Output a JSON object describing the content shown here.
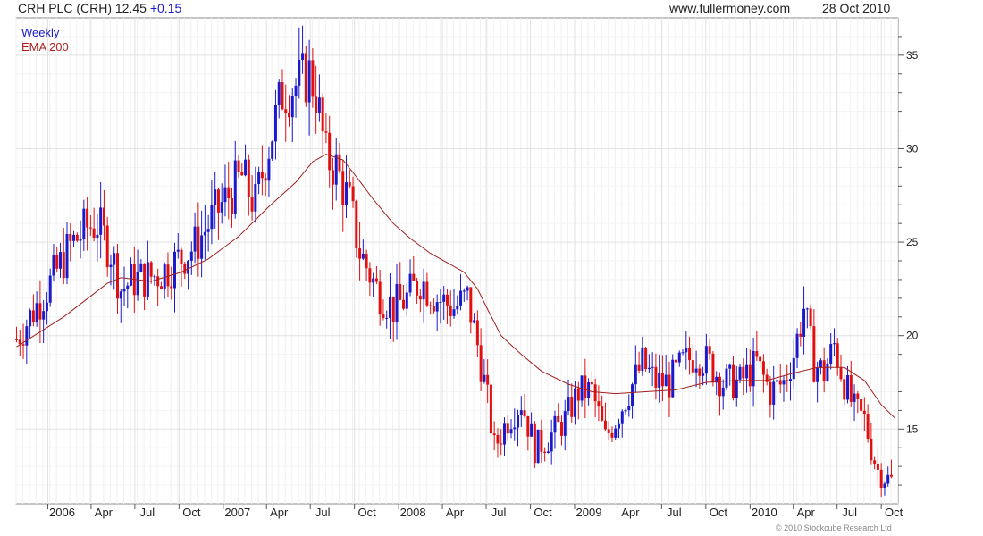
{
  "header": {
    "title": "CRH PLC (CRH) 12.45",
    "change": "+0.15",
    "site": "www.fullermoney.com",
    "date": "28 Oct 2010"
  },
  "legend": {
    "weekly": "Weekly",
    "ema": "EMA 200"
  },
  "copyright": "© 2010 Stockcube Research Ltd",
  "colors": {
    "up": "#1a1acc",
    "down": "#e01010",
    "ema": "#a02020",
    "grid": "#e2e2e2"
  },
  "chart_data": {
    "type": "candlestick",
    "title": "CRH PLC (CRH) 12.45 +0.15",
    "ylim": [
      11,
      37
    ],
    "yticks": [
      15,
      20,
      25,
      30,
      35
    ],
    "xlim": [
      "2005-10-27",
      "2010-11-05"
    ],
    "xticks": [
      {
        "label": "2006",
        "date": "2006-01-01"
      },
      {
        "label": "Apr",
        "date": "2006-04-01"
      },
      {
        "label": "Jul",
        "date": "2006-07-01"
      },
      {
        "label": "Oct",
        "date": "2006-10-01"
      },
      {
        "label": "2007",
        "date": "2007-01-01"
      },
      {
        "label": "Apr",
        "date": "2007-04-01"
      },
      {
        "label": "Jul",
        "date": "2007-07-01"
      },
      {
        "label": "Oct",
        "date": "2007-10-01"
      },
      {
        "label": "2008",
        "date": "2008-01-01"
      },
      {
        "label": "Apr",
        "date": "2008-04-01"
      },
      {
        "label": "Jul",
        "date": "2008-07-01"
      },
      {
        "label": "Oct",
        "date": "2008-10-01"
      },
      {
        "label": "2009",
        "date": "2009-01-01"
      },
      {
        "label": "Apr",
        "date": "2009-04-01"
      },
      {
        "label": "Jul",
        "date": "2009-07-01"
      },
      {
        "label": "Oct",
        "date": "2009-10-01"
      },
      {
        "label": "2010",
        "date": "2010-01-01"
      },
      {
        "label": "Apr",
        "date": "2010-04-01"
      },
      {
        "label": "Jul",
        "date": "2010-07-01"
      },
      {
        "label": "Oct",
        "date": "2010-10-01"
      }
    ],
    "price_anchors": [
      [
        "2005-10-28",
        19.8
      ],
      [
        "2006-01-06",
        22.8
      ],
      [
        "2006-02-17",
        24.8
      ],
      [
        "2006-03-24",
        25.8
      ],
      [
        "2006-04-14",
        26.0
      ],
      [
        "2006-05-12",
        24.5
      ],
      [
        "2006-06-02",
        22.5
      ],
      [
        "2006-06-30",
        23.0
      ],
      [
        "2006-08-11",
        23.2
      ],
      [
        "2006-09-08",
        23.6
      ],
      [
        "2006-11-03",
        24.8
      ],
      [
        "2006-12-15",
        26.5
      ],
      [
        "2007-02-09",
        28.5
      ],
      [
        "2007-03-09",
        27.0
      ],
      [
        "2007-03-30",
        29.5
      ],
      [
        "2007-05-04",
        33.0
      ],
      [
        "2007-06-08",
        33.5
      ],
      [
        "2007-06-29",
        34.0
      ],
      [
        "2007-07-13",
        33.0
      ],
      [
        "2007-08-03",
        29.5
      ],
      [
        "2007-08-24",
        29.0
      ],
      [
        "2007-09-21",
        27.0
      ],
      [
        "2007-10-12",
        24.5
      ],
      [
        "2007-11-16",
        22.5
      ],
      [
        "2007-12-21",
        21.5
      ],
      [
        "2008-01-18",
        22.0
      ],
      [
        "2008-02-15",
        23.0
      ],
      [
        "2008-03-21",
        22.0
      ],
      [
        "2008-04-25",
        21.5
      ],
      [
        "2008-05-23",
        22.0
      ],
      [
        "2008-06-13",
        19.5
      ],
      [
        "2008-07-04",
        16.5
      ],
      [
        "2008-07-18",
        14.0
      ],
      [
        "2008-08-15",
        15.5
      ],
      [
        "2008-09-12",
        16.5
      ],
      [
        "2008-10-10",
        14.0
      ],
      [
        "2008-11-07",
        14.5
      ],
      [
        "2008-12-12",
        15.5
      ],
      [
        "2009-01-09",
        17.0
      ],
      [
        "2009-02-06",
        17.0
      ],
      [
        "2009-03-06",
        14.5
      ],
      [
        "2009-03-27",
        15.5
      ],
      [
        "2009-04-24",
        17.0
      ],
      [
        "2009-05-22",
        18.5
      ],
      [
        "2009-06-19",
        17.5
      ],
      [
        "2009-07-17",
        17.5
      ],
      [
        "2009-08-14",
        18.5
      ],
      [
        "2009-09-11",
        19.0
      ],
      [
        "2009-10-09",
        18.5
      ],
      [
        "2009-11-06",
        17.5
      ],
      [
        "2009-12-11",
        17.5
      ],
      [
        "2010-01-15",
        18.5
      ],
      [
        "2010-02-12",
        17.0
      ],
      [
        "2010-03-12",
        17.5
      ],
      [
        "2010-04-02",
        19.0
      ],
      [
        "2010-04-23",
        21.5
      ],
      [
        "2010-05-14",
        18.5
      ],
      [
        "2010-06-04",
        18.0
      ],
      [
        "2010-06-25",
        19.5
      ],
      [
        "2010-07-16",
        17.5
      ],
      [
        "2010-08-06",
        16.0
      ],
      [
        "2010-08-27",
        15.5
      ],
      [
        "2010-09-10",
        14.0
      ],
      [
        "2010-09-24",
        12.8
      ],
      [
        "2010-10-15",
        12.3
      ],
      [
        "2010-10-28",
        12.45
      ]
    ],
    "ema_200": [
      [
        "2005-10-28",
        19.4
      ],
      [
        "2006-02-03",
        21.0
      ],
      [
        "2006-05-05",
        22.8
      ],
      [
        "2006-06-02",
        23.1
      ],
      [
        "2006-08-04",
        22.9
      ],
      [
        "2006-10-06",
        23.4
      ],
      [
        "2006-12-01",
        24.1
      ],
      [
        "2007-02-02",
        25.3
      ],
      [
        "2007-04-06",
        26.9
      ],
      [
        "2007-06-01",
        28.2
      ],
      [
        "2007-07-06",
        29.3
      ],
      [
        "2007-08-03",
        29.7
      ],
      [
        "2007-09-07",
        29.4
      ],
      [
        "2007-10-05",
        28.5
      ],
      [
        "2007-11-09",
        27.3
      ],
      [
        "2007-12-21",
        26.0
      ],
      [
        "2008-01-25",
        25.2
      ],
      [
        "2008-03-07",
        24.4
      ],
      [
        "2008-04-11",
        23.9
      ],
      [
        "2008-05-16",
        23.4
      ],
      [
        "2008-06-13",
        22.5
      ],
      [
        "2008-07-04",
        21.4
      ],
      [
        "2008-08-01",
        20.0
      ],
      [
        "2008-09-12",
        19.0
      ],
      [
        "2008-10-24",
        18.1
      ],
      [
        "2008-12-19",
        17.4
      ],
      [
        "2009-02-06",
        17.0
      ],
      [
        "2009-03-27",
        16.9
      ],
      [
        "2009-05-29",
        17.0
      ],
      [
        "2009-07-31",
        17.1
      ],
      [
        "2009-10-02",
        17.5
      ],
      [
        "2009-12-04",
        17.6
      ],
      [
        "2010-02-05",
        17.6
      ],
      [
        "2010-04-02",
        18.0
      ],
      [
        "2010-05-21",
        18.3
      ],
      [
        "2010-07-16",
        18.3
      ],
      [
        "2010-08-27",
        17.6
      ],
      [
        "2010-10-01",
        16.3
      ],
      [
        "2010-10-29",
        15.6
      ]
    ]
  }
}
